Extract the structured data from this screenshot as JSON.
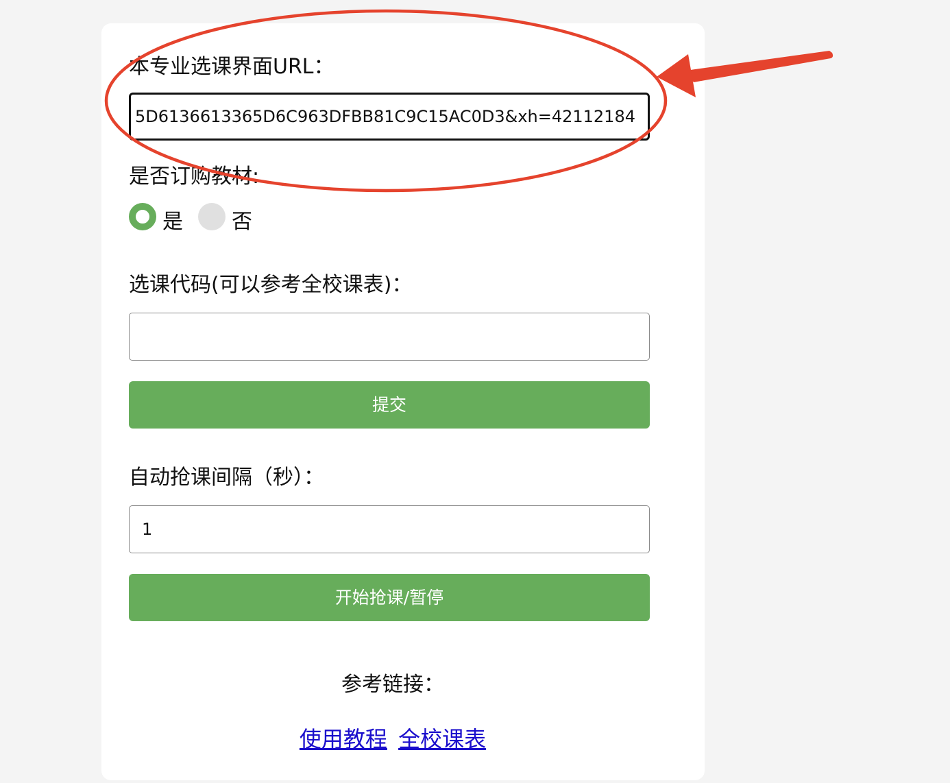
{
  "form": {
    "url_label": "本专业选课界面URL：",
    "url_value": "5D6136613365D6C963DFBB81C9C15AC0D3&xh=42112184",
    "textbook_label": "是否订购教材:",
    "radio_yes_label": "是",
    "radio_no_label": "否",
    "radio_selected": "是",
    "course_code_label": "选课代码(可以参考全校课表)：",
    "course_code_value": "",
    "submit_label": "提交",
    "interval_label": "自动抢课间隔（秒）：",
    "interval_value": "1",
    "start_pause_label": "开始抢课/暂停"
  },
  "references": {
    "label": "参考链接：",
    "links": [
      "使用教程",
      "全校课表"
    ]
  },
  "colors": {
    "accent_green": "#67ad5b",
    "annotation_red": "#e5432d",
    "link_blue": "#1a0dcc"
  }
}
